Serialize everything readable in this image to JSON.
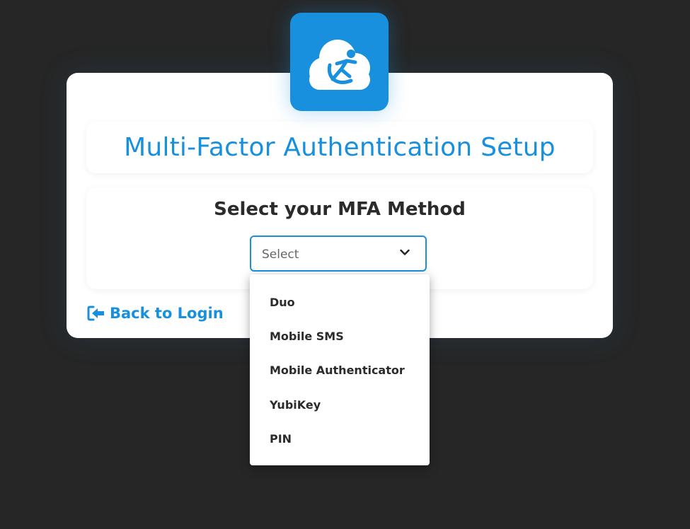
{
  "logo": {
    "icon": "cloud-runner-logo-icon"
  },
  "page": {
    "title": "Multi-Factor Authentication Setup",
    "method_heading": "Select your MFA Method"
  },
  "select": {
    "value": "Select",
    "icon": "chevron-down-icon"
  },
  "dropdown": {
    "options": [
      {
        "label": "Duo"
      },
      {
        "label": "Mobile SMS"
      },
      {
        "label": "Mobile Authenticator"
      },
      {
        "label": "YubiKey"
      },
      {
        "label": "PIN"
      }
    ]
  },
  "back_link": {
    "label": "Back to Login",
    "icon": "sign-out-arrow-icon"
  },
  "colors": {
    "background": "#262626",
    "accent": "#1890dd",
    "card": "#ffffff",
    "text": "#2b2b2b"
  }
}
